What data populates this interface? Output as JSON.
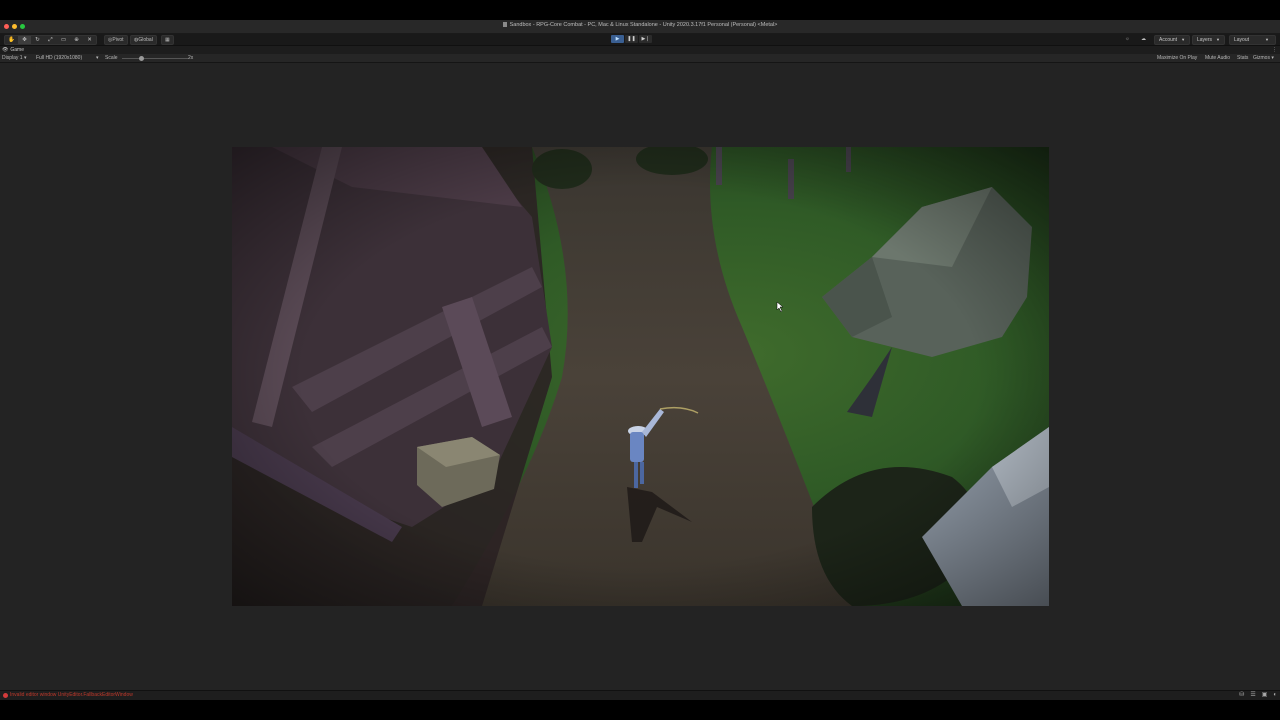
{
  "window": {
    "title": "Sandbox - RPG-Core Combat - PC, Mac & Linux Standalone - Unity 2020.3.17f1 Personal (Personal) <Metal>"
  },
  "toolbar": {
    "tools": [
      {
        "name": "hand-tool-button",
        "icon": "✋"
      },
      {
        "name": "move-tool-button",
        "icon": "✥"
      },
      {
        "name": "rotate-tool-button",
        "icon": "↻"
      },
      {
        "name": "scale-tool-button",
        "icon": "⤢"
      },
      {
        "name": "rect-tool-button",
        "icon": "▭"
      },
      {
        "name": "transform-tool-button",
        "icon": "⊕"
      },
      {
        "name": "custom-tool-button",
        "icon": "✕"
      }
    ],
    "pivot_label": "Pivot",
    "global_label": "Global",
    "grid_icon": "▦",
    "play_icon": "▶",
    "pause_icon": "❚❚",
    "step_icon": "▶❘",
    "account_label": "Account",
    "layers_label": "Layers",
    "layout_label": "Layout",
    "collab_icon": "☁",
    "services_icon": "☼"
  },
  "tabs": [
    {
      "label": "Game",
      "icon": "eye-icon"
    }
  ],
  "tab_more": "⋮",
  "game_bar": {
    "display": "Display 1",
    "resolution": "Full HD (1920x1080)",
    "scale_label": "Scale",
    "scale_value": "2x",
    "maximize": "Maximize On Play",
    "mute": "Mute Audio",
    "stats": "Stats",
    "gizmos": "Gizmos"
  },
  "status": {
    "error_text": "Invalid editor window UnityEditor.FallbackEditorWindow"
  },
  "colors": {
    "play_active": "#3a5f92",
    "error": "#d23b3b"
  }
}
